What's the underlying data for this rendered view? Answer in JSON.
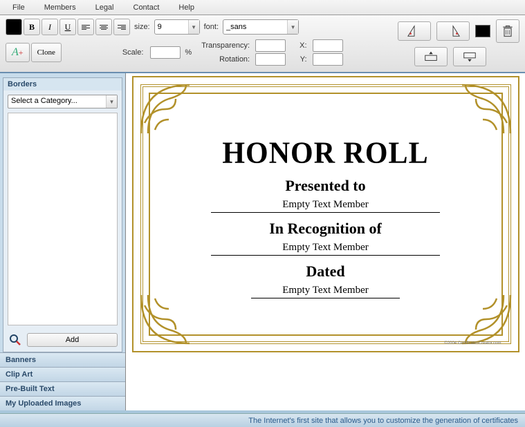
{
  "menu": {
    "file": "File",
    "members": "Members",
    "legal": "Legal",
    "contact": "Contact",
    "help": "Help"
  },
  "toolbar": {
    "bold": "B",
    "italic": "I",
    "underline": "U",
    "size_label": "size:",
    "size_value": "9",
    "font_label": "font:",
    "font_value": "_sans",
    "clone": "Clone",
    "scale_label": "Scale:",
    "scale_value": "",
    "scale_unit": "%",
    "transparency_label": "Transparency:",
    "transparency_value": "",
    "rotation_label": "Rotation:",
    "rotation_value": "",
    "x_label": "X:",
    "x_value": "",
    "y_label": "Y:",
    "y_value": ""
  },
  "sidebar": {
    "active_title": "Borders",
    "category_placeholder": "Select a Category...",
    "add": "Add",
    "sections": {
      "banners": "Banners",
      "clipart": "Clip Art",
      "prebuilt": "Pre-Built Text",
      "uploaded": "My Uploaded Images"
    }
  },
  "certificate": {
    "title": "HONOR ROLL",
    "presented": "Presented to",
    "name_value": "Empty Text Member",
    "recognition": "In Recognition of",
    "recognition_value": "Empty Text Member",
    "dated": "Dated",
    "dated_value": "Empty Text Member",
    "footer": "©2004 CertificatesCreator.com"
  },
  "status": "The Internet's first site that allows you to customize the generation of certificates"
}
